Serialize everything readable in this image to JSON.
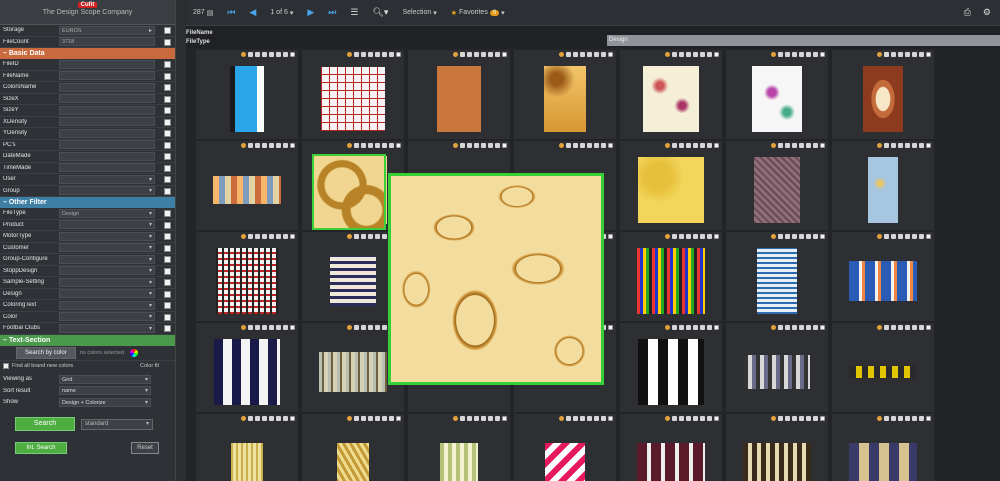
{
  "sidebar": {
    "logo": "Cufit",
    "company": "The Design Scope Company",
    "top_rows": [
      {
        "label": "Storage",
        "value": "EUROS"
      },
      {
        "label": "FileCount",
        "value": "3718"
      }
    ],
    "basic_data_title": "– Basic Data",
    "basic_rows": [
      {
        "label": "FileID"
      },
      {
        "label": "FileName"
      },
      {
        "label": "ColorsName"
      },
      {
        "label": "SizeX"
      },
      {
        "label": "SizeY"
      },
      {
        "label": "XDensity"
      },
      {
        "label": "YDensity"
      },
      {
        "label": "PC's"
      },
      {
        "label": "DateMade"
      },
      {
        "label": "TimeMade"
      },
      {
        "label": "User"
      },
      {
        "label": "Group"
      }
    ],
    "other_filter_title": "– Other Filter",
    "filter_rows": [
      {
        "label": "FileType",
        "value": "Design"
      },
      {
        "label": "Product"
      },
      {
        "label": "MotorType"
      },
      {
        "label": "Customer"
      },
      {
        "label": "Group-Configure"
      },
      {
        "label": "StoppDesign"
      },
      {
        "label": "Sample-Setting"
      },
      {
        "label": "Design"
      },
      {
        "label": "ColoringText"
      },
      {
        "label": "Color"
      },
      {
        "label": "Footbal Clubs"
      }
    ],
    "text_section_title": "– Text-Section",
    "search_by_color_label": "Search by color",
    "search_by_color_placeholder": "no colors selected",
    "brand_color_label": "Find all brand new colors",
    "color_count": "Color fit",
    "view_rows": [
      {
        "label": "Viewing as",
        "value": "Grid"
      },
      {
        "label": "Sort result",
        "value": "name"
      },
      {
        "label": "Show",
        "value": "Design + Colorize"
      }
    ],
    "search_button": "Search",
    "search_mode": "standard",
    "int_search_button": "Int. Search",
    "reset_button": "Reset"
  },
  "toolbar": {
    "count": "287",
    "page": "1 of 6",
    "selection": "Selection",
    "favorites": "Favorites",
    "favorites_count": "0"
  },
  "header": {
    "filename_label": "FileName",
    "filetype_label": "FileType",
    "drop_label": "Design"
  },
  "colors": {
    "accent_green": "#4fae42",
    "section_orange": "#c8693e",
    "section_blue": "#3e7fa6",
    "selection": "#35d035"
  }
}
